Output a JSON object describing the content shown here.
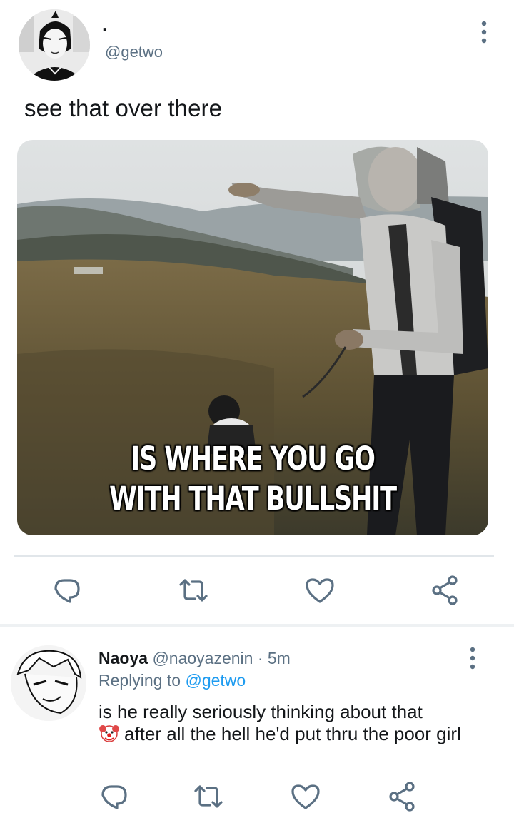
{
  "tweet": {
    "display_name": ".",
    "handle": "@getwo",
    "text": "see that over there",
    "media": {
      "caption_line1": "IS WHERE YOU GO",
      "caption_line2": "WITH THAT BULLSHIT"
    },
    "more_icon": "more-vertical-icon"
  },
  "actions": [
    "reply-icon",
    "retweet-icon",
    "like-icon",
    "share-icon"
  ],
  "reply": {
    "name": "Naoya",
    "handle": "@naoyazenin",
    "separator": "·",
    "time": "5m",
    "replying_label": "Replying to",
    "replying_handle": "@getwo",
    "text_part1": "is he really seriously thinking about that",
    "emoji": "clown-face-emoji",
    "text_part2": "after all the hell he'd put thru the poor girl"
  },
  "colors": {
    "text": "#14171a",
    "secondary": "#5b7083",
    "link": "#1d9bf0",
    "icon": "#5b7083",
    "divider": "#e1e6ea"
  }
}
